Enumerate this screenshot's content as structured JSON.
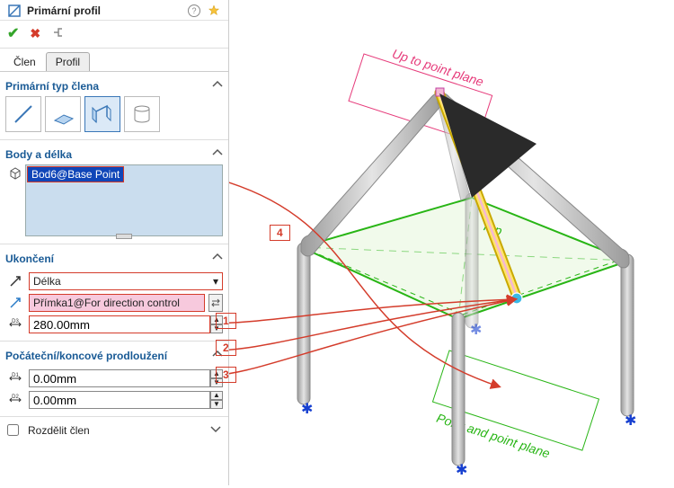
{
  "panel": {
    "title": "Primární profil",
    "tabs": {
      "tab_member": "Člen",
      "tab_profile": "Profil"
    }
  },
  "member_type": {
    "header": "Primární typ člena"
  },
  "body_length": {
    "header": "Body a délka",
    "selection": "Bod6@Base Point"
  },
  "termination": {
    "header": "Ukončení",
    "type_value": "Délka",
    "direction_value": "Přímka1@For direction control",
    "length_value": "280.00mm"
  },
  "extension": {
    "header": "Počáteční/koncové prodloužení",
    "start": "0.00mm",
    "end": "0.00mm"
  },
  "split": {
    "label": "Rozdělit člen"
  },
  "viewport": {
    "label_up_plane": "Up to point plane",
    "label_top": "Top",
    "label_point_plane": "Point and point plane"
  },
  "callouts": {
    "c1": "1",
    "c2": "2",
    "c3": "3",
    "c4": "4"
  }
}
